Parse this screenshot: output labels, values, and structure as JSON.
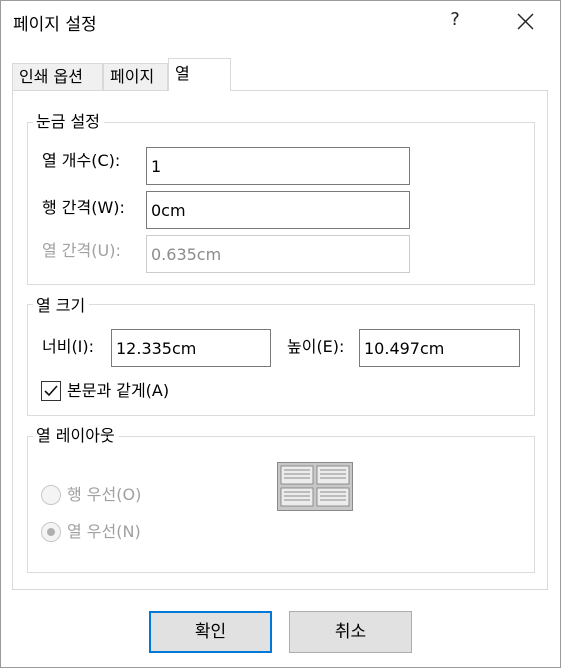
{
  "window": {
    "title": "페이지 설정",
    "help_label": "?"
  },
  "tabs": [
    {
      "label": "인쇄 옵션"
    },
    {
      "label": "페이지"
    },
    {
      "label": "열"
    }
  ],
  "scale_group": {
    "legend": "눈금 설정",
    "column_count": {
      "label": "열 개수(C):",
      "value": "1"
    },
    "row_spacing": {
      "label": "행 간격(W):",
      "value": "0cm"
    },
    "column_spacing": {
      "label": "열 간격(U):",
      "value": "0.635cm"
    }
  },
  "size_group": {
    "legend": "열 크기",
    "width": {
      "label": "너비(I):",
      "value": "12.335cm"
    },
    "height": {
      "label": "높이(E):",
      "value": "10.497cm"
    },
    "same_as_body": {
      "label": "본문과 같게(A)",
      "checked": true
    }
  },
  "layout_group": {
    "legend": "열 레이아웃",
    "row_first": {
      "label": "행 우선(O)",
      "selected": false
    },
    "column_first": {
      "label": "열 우선(N)",
      "selected": true
    },
    "preview_icon": "column-layout-preview-icon"
  },
  "buttons": {
    "ok": "확인",
    "cancel": "취소"
  },
  "colors": {
    "accent": "#0078d7",
    "disabled_text": "#a0a0a0",
    "button_face": "#e1e1e1"
  }
}
